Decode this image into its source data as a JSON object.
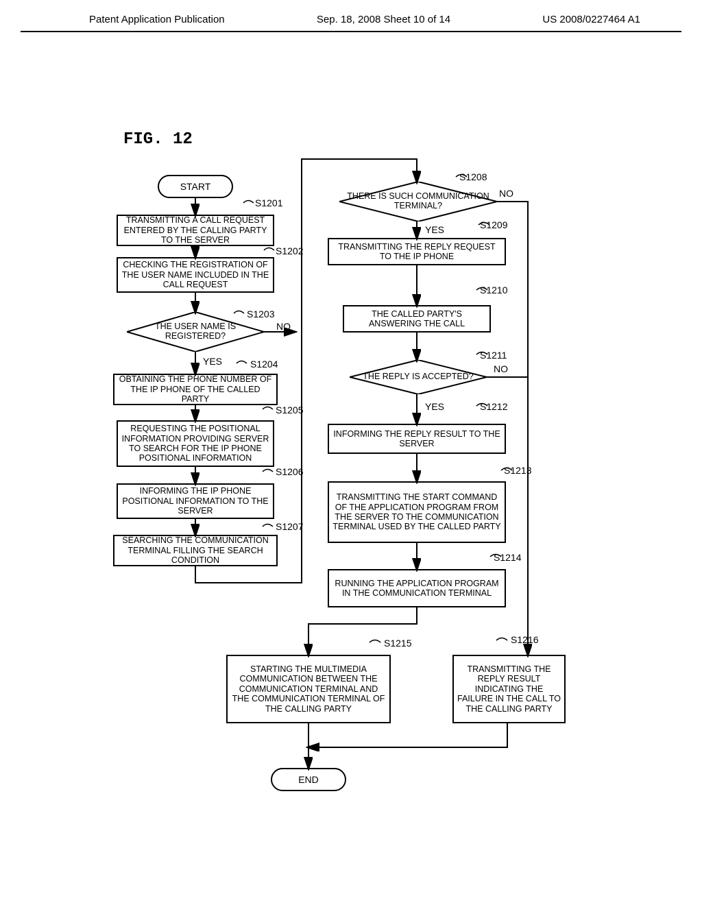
{
  "header": {
    "left": "Patent Application Publication",
    "mid": "Sep. 18, 2008  Sheet 10 of 14",
    "right": "US 2008/0227464 A1"
  },
  "fig": "FIG.  12",
  "terminals": {
    "start": "START",
    "end": "END"
  },
  "steps": {
    "s1201": {
      "num": "S1201",
      "text": "TRANSMITTING A CALL REQUEST ENTERED BY THE CALLING PARTY TO THE SERVER"
    },
    "s1202": {
      "num": "S1202",
      "text": "CHECKING THE REGISTRATION OF THE USER NAME INCLUDED IN THE CALL REQUEST"
    },
    "s1203": {
      "num": "S1203",
      "text": "THE USER NAME IS REGISTERED?"
    },
    "s1204": {
      "num": "S1204",
      "text": "OBTAINING THE PHONE NUMBER OF THE IP PHONE OF THE CALLED PARTY"
    },
    "s1205": {
      "num": "S1205",
      "text": "REQUESTING THE POSITIONAL INFORMATION PROVIDING SERVER TO SEARCH FOR THE IP PHONE POSITIONAL INFORMATION"
    },
    "s1206": {
      "num": "S1206",
      "text": "INFORMING THE IP PHONE POSITIONAL INFORMATION TO THE SERVER"
    },
    "s1207": {
      "num": "S1207",
      "text": "SEARCHING THE COMMUNICATION TERMINAL FILLING THE SEARCH CONDITION"
    },
    "s1208": {
      "num": "S1208",
      "text": "THERE IS SUCH COMMUNICATION TERMINAL?"
    },
    "s1209": {
      "num": "S1209",
      "text": "TRANSMITTING THE REPLY REQUEST TO THE IP PHONE"
    },
    "s1210": {
      "num": "S1210",
      "text": "THE CALLED PARTY'S ANSWERING THE CALL"
    },
    "s1211": {
      "num": "S1211",
      "text": "THE REPLY IS ACCEPTED?"
    },
    "s1212": {
      "num": "S1212",
      "text": "INFORMING THE REPLY RESULT TO THE SERVER"
    },
    "s1213": {
      "num": "S1213",
      "text": "TRANSMITTING THE START COMMAND OF THE APPLICATION PROGRAM FROM THE SERVER TO THE COMMUNICATION TERMINAL USED BY THE CALLED PARTY"
    },
    "s1214": {
      "num": "S1214",
      "text": "RUNNING THE APPLICATION PROGRAM IN THE COMMUNICATION TERMINAL"
    },
    "s1215": {
      "num": "S1215",
      "text": "STARTING THE MULTIMEDIA COMMUNICATION BETWEEN THE COMMUNICATION TERMINAL AND THE COMMUNICATION TERMINAL OF THE CALLING PARTY"
    },
    "s1216": {
      "num": "S1216",
      "text": "TRANSMITTING THE REPLY RESULT INDICATING THE FAILURE IN THE CALL TO THE CALLING PARTY"
    }
  },
  "branches": {
    "yes": "YES",
    "no": "NO"
  }
}
